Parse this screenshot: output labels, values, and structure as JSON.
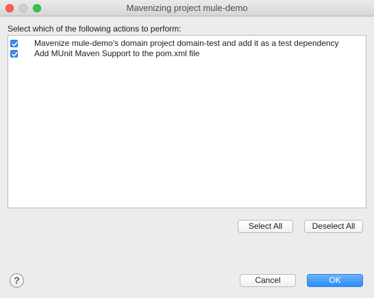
{
  "window": {
    "title": "Mavenizing project mule-demo"
  },
  "prompt": "Select which of the following actions to perform:",
  "actions": [
    {
      "label": "Mavenize mule-demo's domain project domain-test and add it as a test dependency",
      "checked": true
    },
    {
      "label": "Add MUnit Maven Support to the pom.xml file",
      "checked": true
    }
  ],
  "buttons": {
    "select_all": "Select All",
    "deselect_all": "Deselect All",
    "cancel": "Cancel",
    "ok": "OK"
  },
  "help": {
    "glyph": "?",
    "icon": "help-icon"
  },
  "colors": {
    "checkbox": "#3c8bf0",
    "ok_button": "#2a8cf5",
    "close_light": "#fc5f57",
    "zoom_light": "#34c749"
  }
}
